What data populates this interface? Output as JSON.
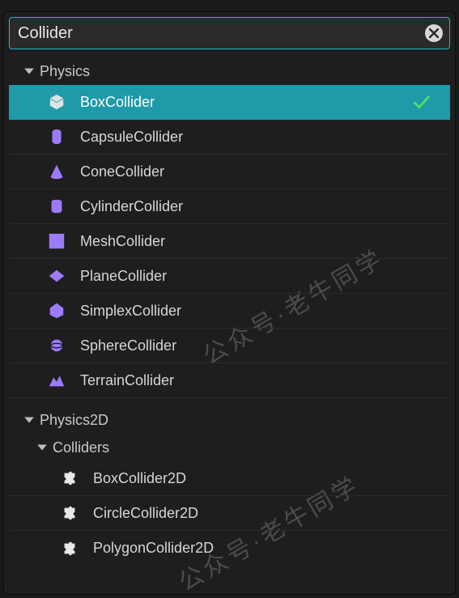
{
  "search": {
    "value": "Collider",
    "placeholder": ""
  },
  "watermark": "公众号·老牛同学",
  "groups": [
    {
      "name": "Physics",
      "expanded": true,
      "items": [
        {
          "label": "BoxCollider",
          "icon": "box",
          "selected": true
        },
        {
          "label": "CapsuleCollider",
          "icon": "capsule",
          "selected": false
        },
        {
          "label": "ConeCollider",
          "icon": "cone",
          "selected": false
        },
        {
          "label": "CylinderCollider",
          "icon": "cylinder",
          "selected": false
        },
        {
          "label": "MeshCollider",
          "icon": "mesh",
          "selected": false
        },
        {
          "label": "PlaneCollider",
          "icon": "plane",
          "selected": false
        },
        {
          "label": "SimplexCollider",
          "icon": "simplex",
          "selected": false
        },
        {
          "label": "SphereCollider",
          "icon": "sphere",
          "selected": false
        },
        {
          "label": "TerrainCollider",
          "icon": "terrain",
          "selected": false
        }
      ]
    },
    {
      "name": "Physics2D",
      "expanded": true,
      "subgroups": [
        {
          "name": "Colliders",
          "expanded": true,
          "items": [
            {
              "label": "BoxCollider2D",
              "icon": "puzzle",
              "selected": false
            },
            {
              "label": "CircleCollider2D",
              "icon": "puzzle",
              "selected": false
            },
            {
              "label": "PolygonCollider2D",
              "icon": "puzzle",
              "selected": false
            }
          ]
        }
      ]
    }
  ]
}
